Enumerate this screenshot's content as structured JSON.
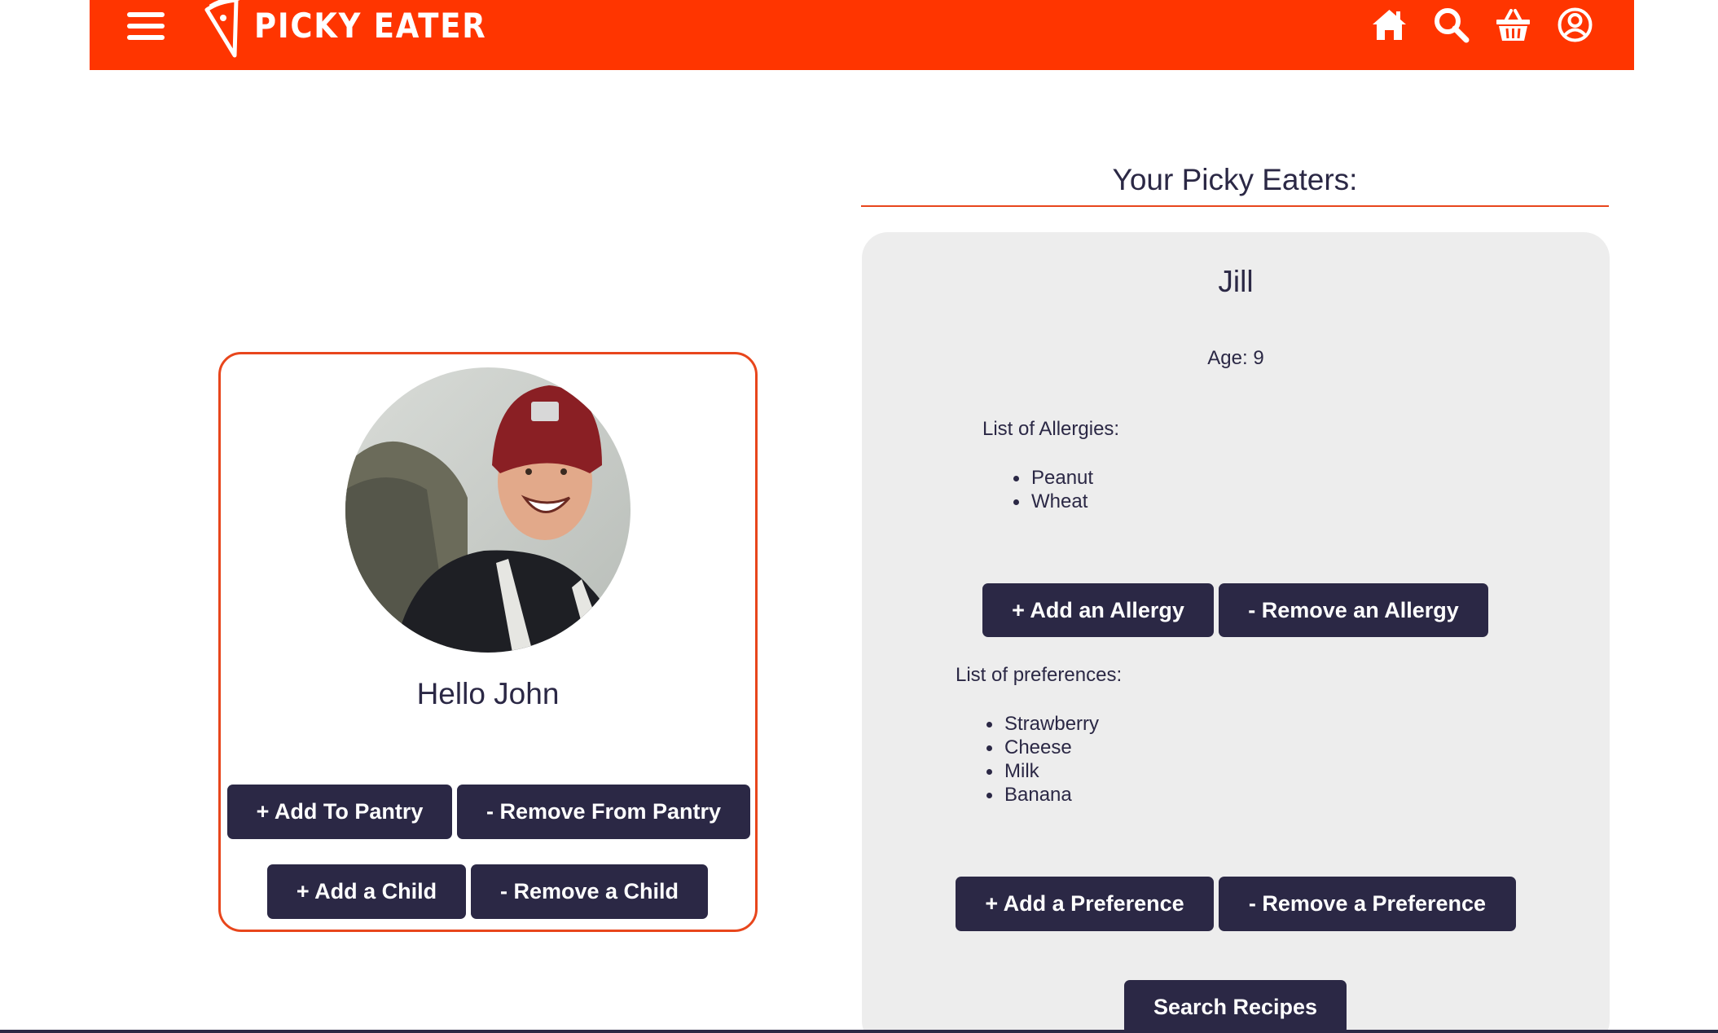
{
  "header": {
    "brand": "PICKY EATER",
    "colors": {
      "accent": "#ff3500",
      "text_on_accent": "#ffffff"
    },
    "icons": [
      "menu-icon",
      "home-icon",
      "search-icon",
      "basket-icon",
      "account-icon"
    ]
  },
  "profile": {
    "greeting": "Hello John",
    "buttons": {
      "add_pantry": "+ Add To Pantry",
      "remove_pantry": "- Remove From Pantry",
      "add_child": "+ Add a Child",
      "remove_child": "- Remove a Child"
    }
  },
  "eaters": {
    "title": "Your Picky Eaters:",
    "child": {
      "name": "Jill",
      "age": "Age: 9",
      "allergies_label": "List of Allergies:",
      "allergies": [
        "Peanut",
        "Wheat"
      ],
      "add_allergy": "+ Add an Allergy",
      "remove_allergy": "- Remove an Allergy",
      "preferences_label": "List of preferences:",
      "preferences": [
        "Strawberry",
        "Cheese",
        "Milk",
        "Banana"
      ],
      "add_preference": "+ Add a Preference",
      "remove_preference": "- Remove a Preference",
      "search_recipes": "Search Recipes"
    }
  },
  "colors": {
    "button_bg": "#2b2845",
    "card_border": "#e8461c",
    "panel_bg": "#ededed"
  }
}
